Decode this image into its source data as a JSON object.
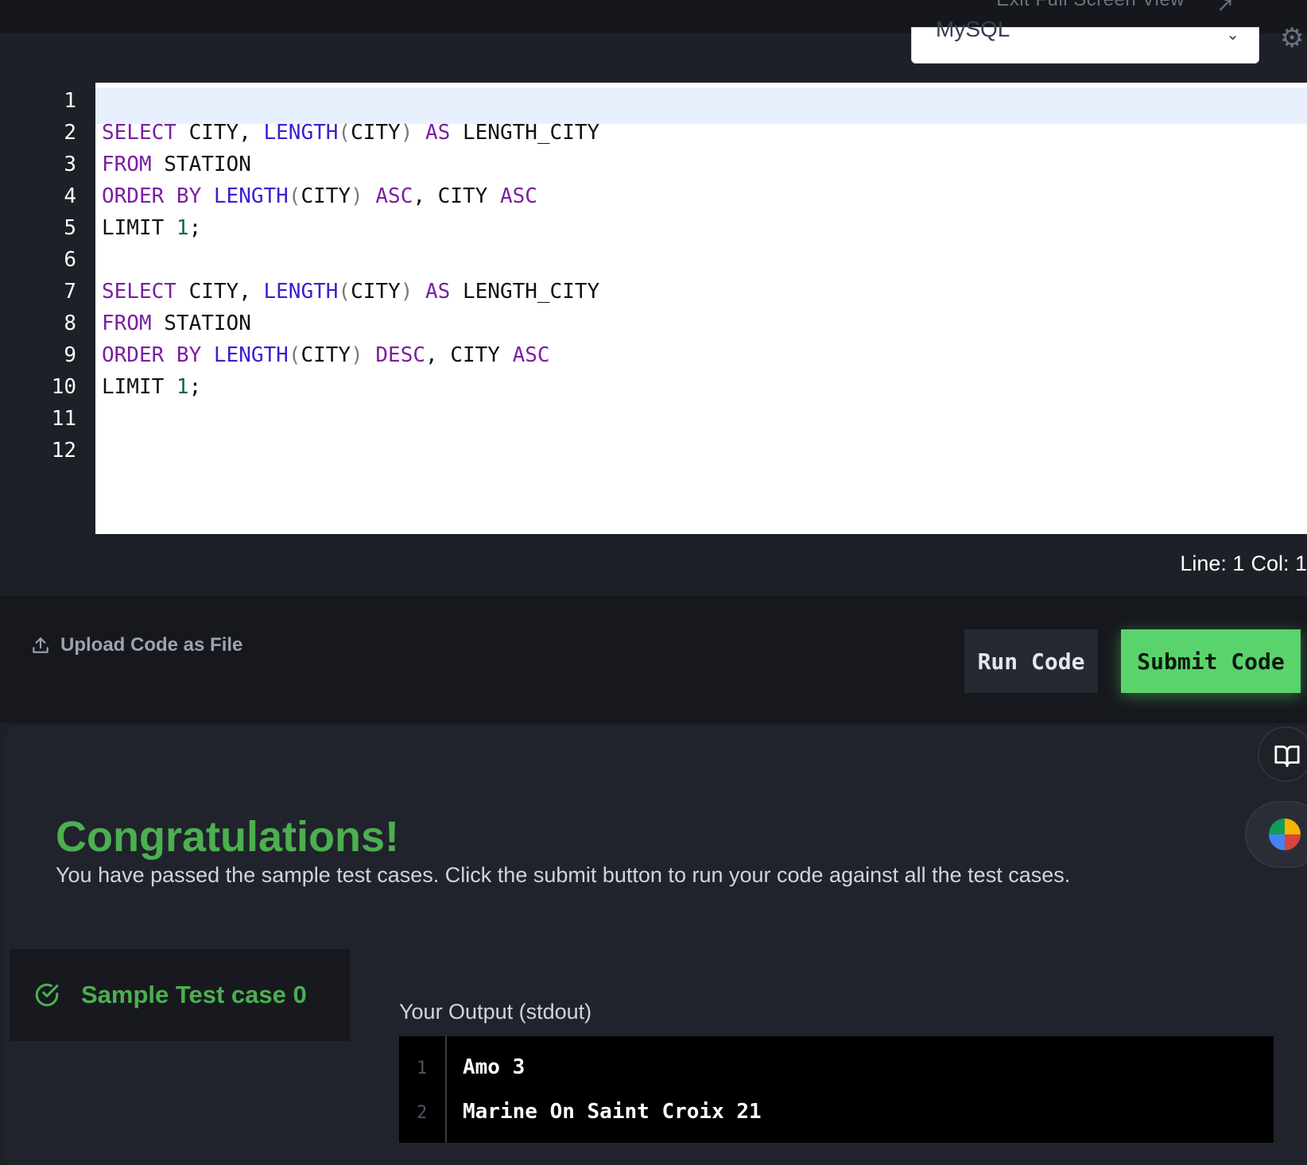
{
  "topbar": {
    "exit_label": "Exit Full Screen View",
    "exit_icon": "arrow-up-right-icon"
  },
  "editor": {
    "language": "MySQL",
    "line_numbers": [
      "1",
      "2",
      "3",
      "4",
      "5",
      "6",
      "7",
      "8",
      "9",
      "10",
      "11",
      "12"
    ],
    "lines": [
      [],
      [
        {
          "t": "SELECT",
          "c": "kw"
        },
        {
          "t": " CITY, ",
          "c": ""
        },
        {
          "t": "LENGTH",
          "c": "fn"
        },
        {
          "t": "(",
          "c": "par"
        },
        {
          "t": "CITY",
          "c": ""
        },
        {
          "t": ")",
          "c": "par"
        },
        {
          "t": " ",
          "c": ""
        },
        {
          "t": "AS",
          "c": "kw"
        },
        {
          "t": " LENGTH_CITY",
          "c": ""
        }
      ],
      [
        {
          "t": "FROM",
          "c": "kw"
        },
        {
          "t": " STATION",
          "c": ""
        }
      ],
      [
        {
          "t": "ORDER BY",
          "c": "kw"
        },
        {
          "t": " ",
          "c": ""
        },
        {
          "t": "LENGTH",
          "c": "fn"
        },
        {
          "t": "(",
          "c": "par"
        },
        {
          "t": "CITY",
          "c": ""
        },
        {
          "t": ")",
          "c": "par"
        },
        {
          "t": " ",
          "c": ""
        },
        {
          "t": "ASC",
          "c": "kw"
        },
        {
          "t": ", CITY ",
          "c": ""
        },
        {
          "t": "ASC",
          "c": "kw"
        }
      ],
      [
        {
          "t": "LIMIT ",
          "c": ""
        },
        {
          "t": "1",
          "c": "num"
        },
        {
          "t": ";",
          "c": ""
        }
      ],
      [],
      [
        {
          "t": "SELECT",
          "c": "kw"
        },
        {
          "t": " CITY, ",
          "c": ""
        },
        {
          "t": "LENGTH",
          "c": "fn"
        },
        {
          "t": "(",
          "c": "par"
        },
        {
          "t": "CITY",
          "c": ""
        },
        {
          "t": ")",
          "c": "par"
        },
        {
          "t": " ",
          "c": ""
        },
        {
          "t": "AS",
          "c": "kw"
        },
        {
          "t": " LENGTH_CITY",
          "c": ""
        }
      ],
      [
        {
          "t": "FROM",
          "c": "kw"
        },
        {
          "t": " STATION",
          "c": ""
        }
      ],
      [
        {
          "t": "ORDER BY",
          "c": "kw"
        },
        {
          "t": " ",
          "c": ""
        },
        {
          "t": "LENGTH",
          "c": "fn"
        },
        {
          "t": "(",
          "c": "par"
        },
        {
          "t": "CITY",
          "c": ""
        },
        {
          "t": ")",
          "c": "par"
        },
        {
          "t": " ",
          "c": ""
        },
        {
          "t": "DESC",
          "c": "kw"
        },
        {
          "t": ", CITY ",
          "c": ""
        },
        {
          "t": "ASC",
          "c": "kw"
        }
      ],
      [
        {
          "t": "LIMIT ",
          "c": ""
        },
        {
          "t": "1",
          "c": "num"
        },
        {
          "t": ";",
          "c": ""
        }
      ],
      [],
      []
    ],
    "status_line": "Line: 1",
    "status_col": "Col: 1"
  },
  "actions": {
    "upload_label": "Upload Code as File",
    "run_label": "Run Code",
    "submit_label": "Submit Code",
    "submit_color": "#5bd36c"
  },
  "results": {
    "title": "Congratulations!",
    "message": "You have passed the sample test cases. Click the submit button to run your code against all the test cases.",
    "testcase_label": "Sample Test case 0",
    "output_title": "Your Output (stdout)",
    "output_lines": [
      {
        "num": "1",
        "text": "Amo 3"
      },
      {
        "num": "2",
        "text": "Marine On Saint Croix 21"
      }
    ],
    "accent": "#4caf50"
  }
}
